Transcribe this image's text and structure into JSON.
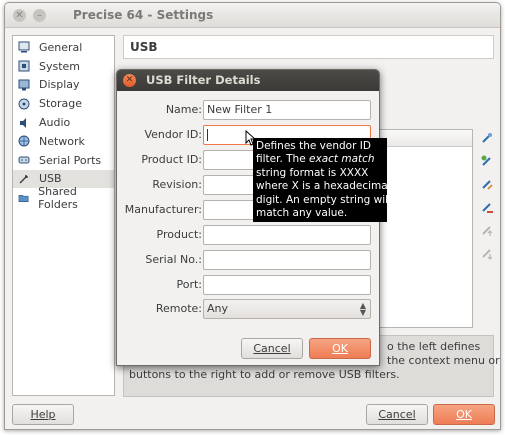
{
  "window": {
    "title": "Precise 64 - Settings",
    "close_glyph": "✕",
    "minimize_glyph": "–"
  },
  "sidebar": {
    "items": [
      {
        "label": "General",
        "icon": "general-icon"
      },
      {
        "label": "System",
        "icon": "system-icon"
      },
      {
        "label": "Display",
        "icon": "display-icon"
      },
      {
        "label": "Storage",
        "icon": "storage-icon"
      },
      {
        "label": "Audio",
        "icon": "audio-icon"
      },
      {
        "label": "Network",
        "icon": "network-icon"
      },
      {
        "label": "Serial Ports",
        "icon": "serial-ports-icon"
      },
      {
        "label": "USB",
        "icon": "usb-icon",
        "selected": true
      },
      {
        "label": "Shared Folders",
        "icon": "shared-folders-icon"
      }
    ]
  },
  "section": {
    "title": "USB"
  },
  "info_text": {
    "line1": "o the left defines",
    "line2": "the context menu or",
    "line3": "buttons to the right to add or remove USB filters."
  },
  "footer": {
    "help_label": "Help",
    "cancel_label": "Cancel",
    "ok_label": "OK"
  },
  "dialog": {
    "title": "USB Filter Details",
    "close_glyph": "✕",
    "fields": {
      "name_label": "Name:",
      "name_value": "New Filter 1",
      "vendor_label": "Vendor ID:",
      "vendor_value": "",
      "product_label": "Product ID:",
      "product_value": "",
      "revision_label": "Revision:",
      "revision_value": "",
      "manufacturer_label": "Manufacturer:",
      "manufacturer_value": "",
      "product_name_label": "Product:",
      "product_name_value": "",
      "serial_label": "Serial No.:",
      "serial_value": "",
      "port_label": "Port:",
      "port_value": "",
      "remote_label": "Remote:",
      "remote_value": "Any"
    },
    "cancel_label": "Cancel",
    "ok_label": "OK"
  },
  "tooltip": {
    "line1": "Defines the vendor ID",
    "line2_pre": "filter. The ",
    "line2_em": "exact match",
    "line3": "string format is XXXX",
    "line4": "where X is a hexadecimal",
    "line5": "digit. An empty string will",
    "line6": "match any value."
  },
  "colors": {
    "accent": "#ee7d55",
    "tooltip_bg": "#000000",
    "dialog_title_bg": "#3b3935"
  }
}
